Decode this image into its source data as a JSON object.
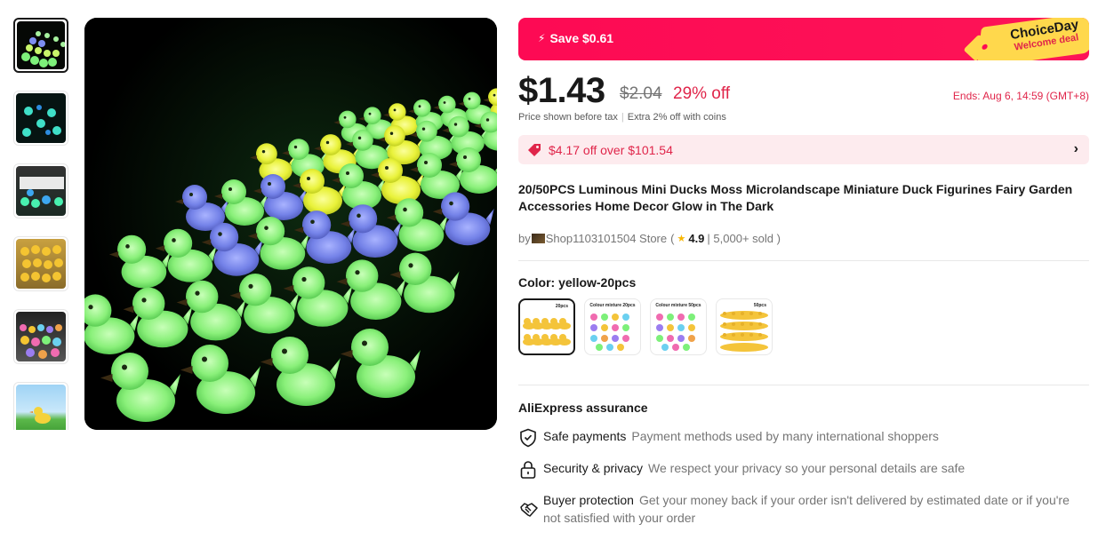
{
  "gallery": {
    "thumbnails": [
      {
        "name": "thumb-glow-ducks-rows",
        "active": true
      },
      {
        "name": "thumb-glow-ducks-blue",
        "active": false
      },
      {
        "name": "thumb-glow-ducks-mixed",
        "active": false
      },
      {
        "name": "thumb-yellow-ducks",
        "active": false
      },
      {
        "name": "thumb-colour-ducks",
        "active": false
      },
      {
        "name": "thumb-duck-on-grass",
        "active": false
      }
    ]
  },
  "promo": {
    "save_text": "Save $0.61",
    "choice_line1": "ChoiceDay",
    "choice_line2": "Welcome deal",
    "accent_color": "#fd0a54",
    "tag_color": "#ffd84c"
  },
  "pricing": {
    "price": "$1.43",
    "original_price": "$2.04",
    "discount": "29% off",
    "ends": "Ends: Aug 6, 14:59 (GMT+8)",
    "tax_note": "Price shown before tax",
    "coin_note": "Extra 2% off with coins"
  },
  "coupon": {
    "text": "$4.17 off over $101.54",
    "chevron": "›"
  },
  "product": {
    "title": "20/50PCS Luminous Mini Ducks Moss Microlandscape Miniature Duck Figurines Fairy Garden Accessories Home Decor Glow in The Dark"
  },
  "store": {
    "by": "by",
    "name": "Shop1103101504 Store",
    "open_paren": "(",
    "star": "★",
    "rating": "4.9",
    "sold": "| 5,000+ sold )"
  },
  "variants": {
    "label": "Color: yellow-20pcs",
    "options": [
      {
        "caption": "20pcs",
        "style": "yellow-20",
        "selected": true
      },
      {
        "caption": "Colour mixture 20pcs",
        "style": "mix-20",
        "selected": false
      },
      {
        "caption": "Colour mixture 50pcs",
        "style": "mix-50",
        "selected": false
      },
      {
        "caption": "50pcs",
        "style": "yellow-50",
        "selected": false
      }
    ]
  },
  "assurance": {
    "title": "AliExpress assurance",
    "items": [
      {
        "icon": "shield-check-icon",
        "label": "Safe payments",
        "desc": "Payment methods used by many international shoppers"
      },
      {
        "icon": "lock-icon",
        "label": "Security & privacy",
        "desc": "We respect your privacy so your personal details are safe"
      },
      {
        "icon": "handshake-icon",
        "label": "Buyer protection",
        "desc": "Get your money back if your order isn't delivered by estimated date or if you're not satisfied with your order"
      }
    ]
  }
}
